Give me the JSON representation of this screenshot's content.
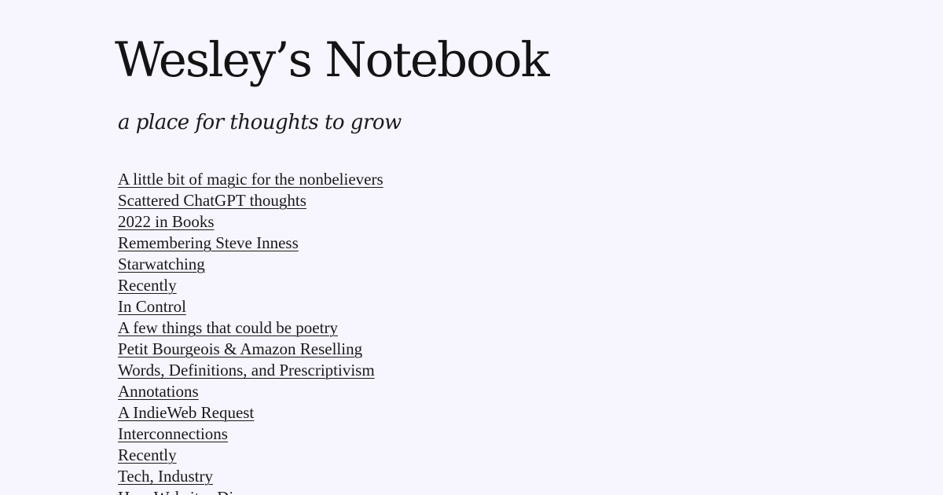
{
  "site": {
    "title": "Wesley’s Notebook",
    "tagline": "a place for thoughts to grow"
  },
  "posts": [
    {
      "title": "A little bit of magic for the nonbelievers"
    },
    {
      "title": "Scattered ChatGPT thoughts"
    },
    {
      "title": "2022 in Books"
    },
    {
      "title": "Remembering Steve Inness"
    },
    {
      "title": "Starwatching"
    },
    {
      "title": "Recently"
    },
    {
      "title": "In Control"
    },
    {
      "title": "A few things that could be poetry"
    },
    {
      "title": "Petit Bourgeois & Amazon Reselling"
    },
    {
      "title": "Words, Definitions, and Prescriptivism"
    },
    {
      "title": "Annotations"
    },
    {
      "title": "A IndieWeb Request"
    },
    {
      "title": "Interconnections"
    },
    {
      "title": "Recently"
    },
    {
      "title": "Tech, Industry"
    },
    {
      "title": "How Websites Die"
    }
  ],
  "colors": {
    "background": "#f7f5fd",
    "text": "#1a1a1a"
  }
}
